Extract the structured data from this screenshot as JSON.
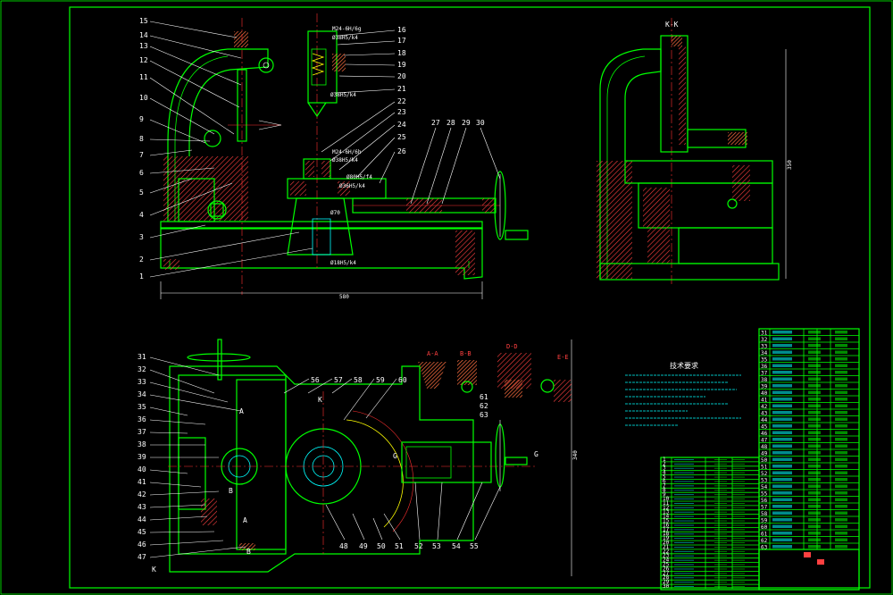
{
  "drawing": {
    "section_kk_label": "K-K",
    "dim_overall_width": "580",
    "dim_kk_height": "350",
    "dim_plan_height": "340",
    "tech_req_title": "技术要求",
    "section_labels": [
      "A-A",
      "B-B",
      "D-D",
      "E-E"
    ],
    "cut_markers": [
      "K",
      "K",
      "G",
      "G",
      "A",
      "B",
      "A",
      "B"
    ],
    "fit_notes": [
      "M24-6H/6g",
      "Ø38H5/k4",
      "Ø38H5/k4",
      "M24-6H/6h",
      "Ø38H5/k4",
      "Ø80H5/f4",
      "Ø36H5/k4",
      "Ø70",
      "Ø18H5/k4"
    ],
    "callouts_front": [
      "15",
      "14",
      "13",
      "12",
      "11",
      "10",
      "9",
      "8",
      "7",
      "6",
      "5",
      "4",
      "3",
      "2",
      "1"
    ],
    "callouts_front_top": [
      "16",
      "17",
      "18",
      "19",
      "20",
      "21",
      "22",
      "23",
      "24",
      "25",
      "26"
    ],
    "callouts_top_right": [
      "27",
      "28",
      "29",
      "30"
    ],
    "callouts_plan_left": [
      "31",
      "32",
      "33",
      "34",
      "35",
      "36",
      "37",
      "38",
      "39",
      "40",
      "41",
      "42",
      "43",
      "44",
      "45",
      "46",
      "47"
    ],
    "callouts_plan_top": [
      "56",
      "57",
      "58",
      "59",
      "60"
    ],
    "callouts_plan_bottom": [
      "48",
      "49",
      "50",
      "51",
      "52",
      "53",
      "54",
      "55"
    ],
    "callouts_detail": [
      "61",
      "62",
      "63"
    ]
  },
  "bom": {
    "right_rows": [
      "31",
      "32",
      "33",
      "34",
      "35",
      "36",
      "37",
      "38",
      "39",
      "40",
      "41",
      "42",
      "43",
      "44",
      "45",
      "46",
      "47",
      "48",
      "49",
      "50",
      "51",
      "52",
      "53",
      "54",
      "55",
      "56",
      "57",
      "58",
      "59",
      "60",
      "61",
      "62",
      "63"
    ],
    "left_rows": [
      "1",
      "2",
      "3",
      "4",
      "5",
      "6",
      "7",
      "8",
      "9",
      "10",
      "11",
      "12",
      "13",
      "14",
      "15",
      "16",
      "17",
      "18",
      "19",
      "20",
      "21",
      "22",
      "23",
      "24",
      "25",
      "26",
      "27",
      "28",
      "29",
      "30"
    ]
  },
  "colors": {
    "frame": "#00ff00",
    "centerline": "#ff3030",
    "hatch": "#ff4040",
    "leader": "#ffffff",
    "cyan": "#00ffff",
    "yellow": "#ffff00"
  }
}
